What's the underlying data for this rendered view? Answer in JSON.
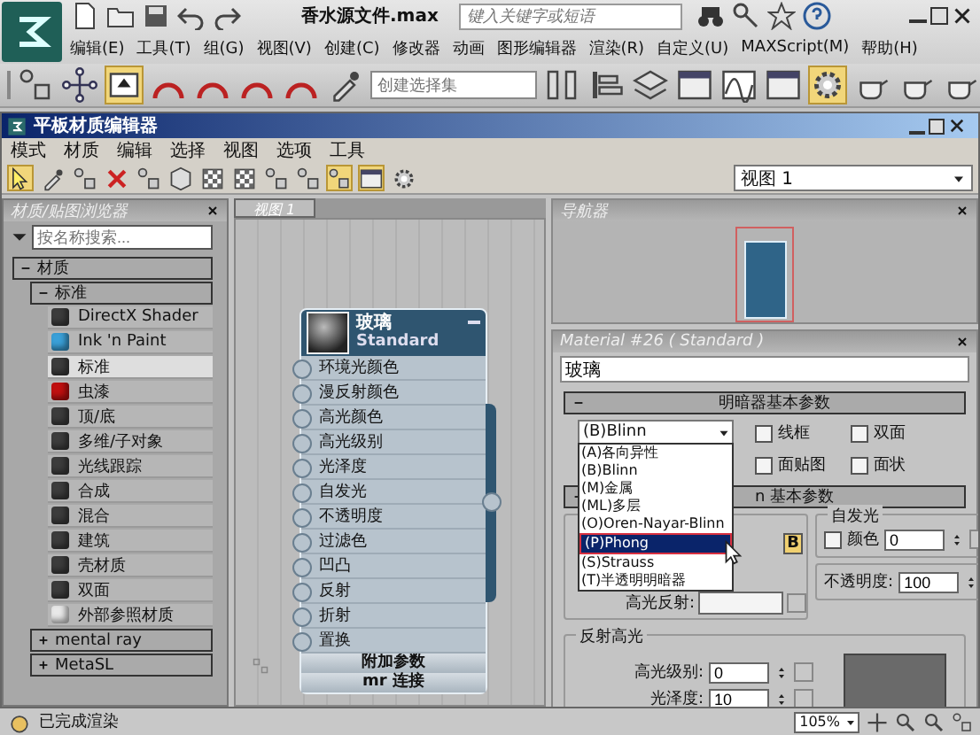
{
  "app": {
    "title": "香水源文件.max",
    "search": {
      "placeholder": "键入关键字或短语"
    },
    "menu": [
      "编辑(E)",
      "工具(T)",
      "组(G)",
      "视图(V)",
      "创建(C)",
      "修改器",
      "动画",
      "图形编辑器",
      "渲染(R)",
      "自定义(U)",
      "MAXScript(M)",
      "帮助(H)"
    ]
  },
  "main_toolbar": {
    "selection_set": {
      "placeholder": "创建选择集"
    }
  },
  "editor": {
    "title": "平板材质编辑器",
    "menu": [
      "模式",
      "材质",
      "编辑",
      "选择",
      "视图",
      "选项",
      "工具"
    ],
    "view_select": "视图 1"
  },
  "browser": {
    "title": "材质/贴图浏览器",
    "search": {
      "placeholder": "按名称搜索..."
    },
    "groups": [
      {
        "label": "材质",
        "expanded": true,
        "children": [
          {
            "label": "标准",
            "expanded": true,
            "items": [
              {
                "label": "DirectX Shader",
                "color": "#3c3c3c",
                "selected": false
              },
              {
                "label": "Ink 'n Paint",
                "color": "#3aa0d8",
                "selected": false
              },
              {
                "label": "标准",
                "color": "#3c3c3c",
                "selected": true
              },
              {
                "label": "虫漆",
                "color": "#c01010",
                "selected": false
              },
              {
                "label": "顶/底",
                "color": "#3c3c3c",
                "selected": false
              },
              {
                "label": "多维/子对象",
                "color": "#3c3c3c",
                "selected": false
              },
              {
                "label": "光线跟踪",
                "color": "#3c3c3c",
                "selected": false
              },
              {
                "label": "合成",
                "color": "#3c3c3c",
                "selected": false
              },
              {
                "label": "混合",
                "color": "#3c3c3c",
                "selected": false
              },
              {
                "label": "建筑",
                "color": "#3c3c3c",
                "selected": false
              },
              {
                "label": "壳材质",
                "color": "#3c3c3c",
                "selected": false
              },
              {
                "label": "双面",
                "color": "#3c3c3c",
                "selected": false
              },
              {
                "label": "外部参照材质",
                "color": "#e8e8e8",
                "selected": false
              }
            ]
          },
          {
            "label": "mental ray",
            "expanded": false
          },
          {
            "label": "MetaSL",
            "expanded": false
          }
        ]
      }
    ]
  },
  "view": {
    "tab": "视图 1",
    "node": {
      "title": "玻璃",
      "type": "Standard",
      "slots": [
        "环境光颜色",
        "漫反射颜色",
        "高光颜色",
        "高光级别",
        "光泽度",
        "自发光",
        "不透明度",
        "过滤色",
        "凹凸",
        "反射",
        "折射",
        "置换"
      ],
      "sections": [
        "附加参数",
        "mr 连接"
      ]
    }
  },
  "navigator": {
    "title": "导航器"
  },
  "params": {
    "title": "Material #26 ( Standard )",
    "name": "玻璃",
    "shader_rollout": "明暗器基本参数",
    "shader": "(B)Blinn",
    "shader_options": [
      {
        "label": "(A)各向异性",
        "selected": false
      },
      {
        "label": "(B)Blinn",
        "selected": false
      },
      {
        "label": "(M)金属",
        "selected": false
      },
      {
        "label": "(ML)多层",
        "selected": false
      },
      {
        "label": "(O)Oren-Nayar-Blinn",
        "selected": false
      },
      {
        "label": "(P)Phong",
        "selected": true
      },
      {
        "label": "(S)Strauss",
        "selected": false
      },
      {
        "label": "(T)半透明明暗器",
        "selected": false
      }
    ],
    "checkboxes": [
      {
        "label": "线框",
        "checked": false
      },
      {
        "label": "双面",
        "checked": false
      },
      {
        "label": "面贴图",
        "checked": false
      },
      {
        "label": "面状",
        "checked": false
      }
    ],
    "basic_rollout": "n 基本参数",
    "self_illum": {
      "title": "自发光",
      "color_label": "颜色",
      "color_checked": false,
      "value": "0"
    },
    "lock": "B",
    "specular_label": "高光反射:",
    "opacity": {
      "label": "不透明度:",
      "value": "100"
    },
    "highlights": {
      "title": "反射高光",
      "level_label": "高光级别:",
      "level": "0",
      "gloss_label": "光泽度:",
      "gloss": "10"
    }
  },
  "status_bar": {
    "text": "已完成渲染",
    "zoom": "105%"
  }
}
